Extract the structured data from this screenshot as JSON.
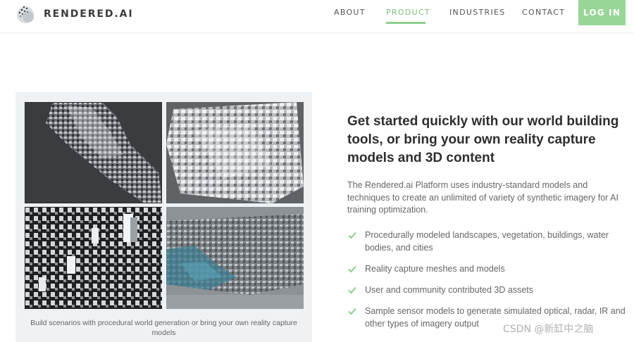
{
  "brand": {
    "name": "RENDERED.AI",
    "logo_icon": "dotted-circle-logo"
  },
  "nav": {
    "items": [
      {
        "label": "ABOUT",
        "active": false
      },
      {
        "label": "PRODUCT",
        "active": true
      },
      {
        "label": "INDUSTRIES",
        "active": false
      },
      {
        "label": "CONTACT",
        "active": false
      }
    ],
    "login_label": "LOG IN"
  },
  "colors": {
    "accent": "#98d698",
    "active_nav": "#7bbf7b",
    "check": "#8ccf8c",
    "panel_bg": "#eef2f5"
  },
  "gallery": {
    "tiles": [
      {
        "name": "procedural-city-dark"
      },
      {
        "name": "procedural-city-light"
      },
      {
        "name": "dense-city-dark"
      },
      {
        "name": "reality-capture-coastal-city"
      }
    ],
    "caption": "Build scenarios with procedural world generation or bring your own reality capture models"
  },
  "content": {
    "heading": "Get started quickly with our world building tools, or bring your own reality capture models and 3D content",
    "intro": "The Rendered.ai Platform uses industry-standard models and techniques to create an unlimited of variety of synthetic imagery for AI training optimization.",
    "features": [
      "Procedurally modeled landscapes, vegetation, buildings, water bodies, and cities",
      "Reality capture meshes and models",
      "User and community contributed 3D assets",
      "Sample sensor models to generate simulated optical, radar, IR and other types of imagery output"
    ],
    "feature_icon": "check-icon"
  },
  "watermark": "CSDN @新缸中之脑"
}
